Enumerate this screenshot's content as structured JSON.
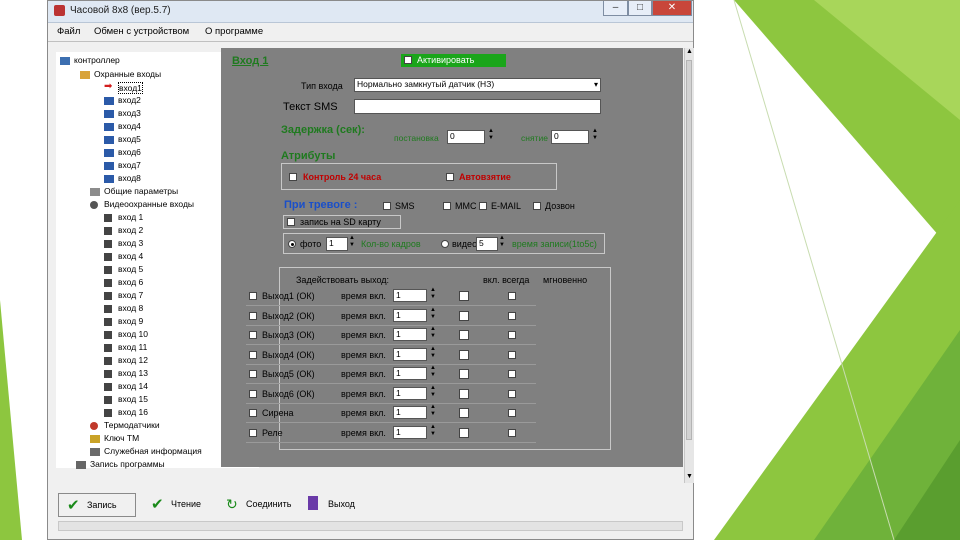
{
  "window": {
    "title": "Часовой 8x8  (вер.5.7)",
    "controls": [
      "–",
      "□",
      "✕"
    ]
  },
  "menu": [
    "Файл",
    "Обмен с устройством",
    "О программе"
  ],
  "tree": {
    "root": "контроллер",
    "guarded_inputs": "Охранные входы",
    "inputs": [
      "вход1",
      "вход2",
      "вход3",
      "вход4",
      "вход5",
      "вход6",
      "вход7",
      "вход8"
    ],
    "common_params": "Общие параметры",
    "video_inputs": "Видеоохранные входы",
    "video_items": [
      "вход 1",
      "вход 2",
      "вход 3",
      "вход 4",
      "вход 5",
      "вход 6",
      "вход 7",
      "вход 8",
      "вход 9",
      "вход 10",
      "вход 11",
      "вход 12",
      "вход 13",
      "вход 14",
      "вход 15",
      "вход 16"
    ],
    "thermo": "Термодатчики",
    "key": "Ключ TM",
    "service": "Служебная информация",
    "write": "Запись программы"
  },
  "panel": {
    "input_title": "Вход 1",
    "activate_label": "Активировать",
    "type_label": "Тип входа",
    "type_value": "Нормально замкнутый датчик (НЗ)",
    "sms_label": "Текст SMS",
    "sms_value": "",
    "delay_label": "Задержка (сек):",
    "on_guard_label": "постановка",
    "on_guard_value": "0",
    "removal_label": "снятие",
    "removal_value": "0",
    "attributes_label": "Атрибуты",
    "control24_label": "Контроль 24 часа",
    "autotake_label": "Автовзятие",
    "alarm_label": "При тревоге :",
    "alarm_opts": [
      "SMS",
      "MMC",
      "E-MAIL",
      "Дозвон"
    ],
    "sd_label": "запись на SD карту",
    "photo_label": "фото",
    "photo_value": "1",
    "frames_label": "Кол-во кадров",
    "video_label": "видео",
    "video_value": "5",
    "video_time_label": "время записи(1to5c)",
    "outputs_header": "Задействовать выход:",
    "on_always_label": "вкл. всегда",
    "instant_label": "мгновенно",
    "outputs": [
      {
        "name": "Выход1 (ОК)",
        "time_label": "время вкл.",
        "value": "1"
      },
      {
        "name": "Выход2 (ОК)",
        "time_label": "время вкл.",
        "value": "1"
      },
      {
        "name": "Выход3 (ОК)",
        "time_label": "время вкл.",
        "value": "1"
      },
      {
        "name": "Выход4 (ОК)",
        "time_label": "время вкл.",
        "value": "1"
      },
      {
        "name": "Выход5 (ОК)",
        "time_label": "время вкл.",
        "value": "1"
      },
      {
        "name": "Выход6 (ОК)",
        "time_label": "время вкл.",
        "value": "1"
      },
      {
        "name": "Сирена",
        "time_label": "время вкл.",
        "value": "1"
      },
      {
        "name": "Реле",
        "time_label": "время вкл.",
        "value": "1"
      }
    ]
  },
  "toolbar": {
    "write": "Запись",
    "read": "Чтение",
    "connect": "Соединить",
    "exit": "Выход"
  },
  "colors": {
    "slide_green_light": "#8dc63f",
    "slide_green_dark": "#5a9e2f",
    "panel_gray": "#808080",
    "label_green": "#1f7a1f",
    "label_red": "#c00000",
    "activate_green": "#1aa51a"
  }
}
